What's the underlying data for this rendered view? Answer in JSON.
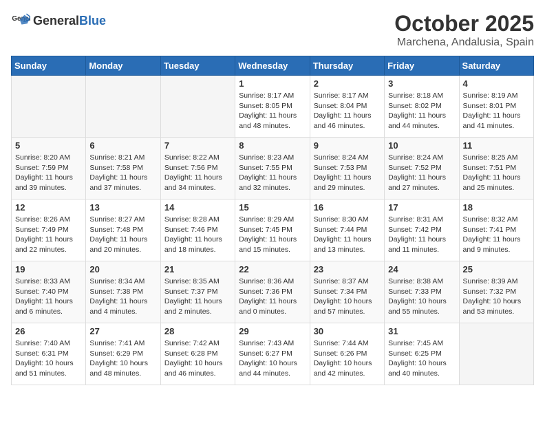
{
  "logo": {
    "general": "General",
    "blue": "Blue"
  },
  "header": {
    "month": "October 2025",
    "location": "Marchena, Andalusia, Spain"
  },
  "weekdays": [
    "Sunday",
    "Monday",
    "Tuesday",
    "Wednesday",
    "Thursday",
    "Friday",
    "Saturday"
  ],
  "weeks": [
    [
      {
        "day": "",
        "info": ""
      },
      {
        "day": "",
        "info": ""
      },
      {
        "day": "",
        "info": ""
      },
      {
        "day": "1",
        "info": "Sunrise: 8:17 AM\nSunset: 8:05 PM\nDaylight: 11 hours and 48 minutes."
      },
      {
        "day": "2",
        "info": "Sunrise: 8:17 AM\nSunset: 8:04 PM\nDaylight: 11 hours and 46 minutes."
      },
      {
        "day": "3",
        "info": "Sunrise: 8:18 AM\nSunset: 8:02 PM\nDaylight: 11 hours and 44 minutes."
      },
      {
        "day": "4",
        "info": "Sunrise: 8:19 AM\nSunset: 8:01 PM\nDaylight: 11 hours and 41 minutes."
      }
    ],
    [
      {
        "day": "5",
        "info": "Sunrise: 8:20 AM\nSunset: 7:59 PM\nDaylight: 11 hours and 39 minutes."
      },
      {
        "day": "6",
        "info": "Sunrise: 8:21 AM\nSunset: 7:58 PM\nDaylight: 11 hours and 37 minutes."
      },
      {
        "day": "7",
        "info": "Sunrise: 8:22 AM\nSunset: 7:56 PM\nDaylight: 11 hours and 34 minutes."
      },
      {
        "day": "8",
        "info": "Sunrise: 8:23 AM\nSunset: 7:55 PM\nDaylight: 11 hours and 32 minutes."
      },
      {
        "day": "9",
        "info": "Sunrise: 8:24 AM\nSunset: 7:53 PM\nDaylight: 11 hours and 29 minutes."
      },
      {
        "day": "10",
        "info": "Sunrise: 8:24 AM\nSunset: 7:52 PM\nDaylight: 11 hours and 27 minutes."
      },
      {
        "day": "11",
        "info": "Sunrise: 8:25 AM\nSunset: 7:51 PM\nDaylight: 11 hours and 25 minutes."
      }
    ],
    [
      {
        "day": "12",
        "info": "Sunrise: 8:26 AM\nSunset: 7:49 PM\nDaylight: 11 hours and 22 minutes."
      },
      {
        "day": "13",
        "info": "Sunrise: 8:27 AM\nSunset: 7:48 PM\nDaylight: 11 hours and 20 minutes."
      },
      {
        "day": "14",
        "info": "Sunrise: 8:28 AM\nSunset: 7:46 PM\nDaylight: 11 hours and 18 minutes."
      },
      {
        "day": "15",
        "info": "Sunrise: 8:29 AM\nSunset: 7:45 PM\nDaylight: 11 hours and 15 minutes."
      },
      {
        "day": "16",
        "info": "Sunrise: 8:30 AM\nSunset: 7:44 PM\nDaylight: 11 hours and 13 minutes."
      },
      {
        "day": "17",
        "info": "Sunrise: 8:31 AM\nSunset: 7:42 PM\nDaylight: 11 hours and 11 minutes."
      },
      {
        "day": "18",
        "info": "Sunrise: 8:32 AM\nSunset: 7:41 PM\nDaylight: 11 hours and 9 minutes."
      }
    ],
    [
      {
        "day": "19",
        "info": "Sunrise: 8:33 AM\nSunset: 7:40 PM\nDaylight: 11 hours and 6 minutes."
      },
      {
        "day": "20",
        "info": "Sunrise: 8:34 AM\nSunset: 7:38 PM\nDaylight: 11 hours and 4 minutes."
      },
      {
        "day": "21",
        "info": "Sunrise: 8:35 AM\nSunset: 7:37 PM\nDaylight: 11 hours and 2 minutes."
      },
      {
        "day": "22",
        "info": "Sunrise: 8:36 AM\nSunset: 7:36 PM\nDaylight: 11 hours and 0 minutes."
      },
      {
        "day": "23",
        "info": "Sunrise: 8:37 AM\nSunset: 7:34 PM\nDaylight: 10 hours and 57 minutes."
      },
      {
        "day": "24",
        "info": "Sunrise: 8:38 AM\nSunset: 7:33 PM\nDaylight: 10 hours and 55 minutes."
      },
      {
        "day": "25",
        "info": "Sunrise: 8:39 AM\nSunset: 7:32 PM\nDaylight: 10 hours and 53 minutes."
      }
    ],
    [
      {
        "day": "26",
        "info": "Sunrise: 7:40 AM\nSunset: 6:31 PM\nDaylight: 10 hours and 51 minutes."
      },
      {
        "day": "27",
        "info": "Sunrise: 7:41 AM\nSunset: 6:29 PM\nDaylight: 10 hours and 48 minutes."
      },
      {
        "day": "28",
        "info": "Sunrise: 7:42 AM\nSunset: 6:28 PM\nDaylight: 10 hours and 46 minutes."
      },
      {
        "day": "29",
        "info": "Sunrise: 7:43 AM\nSunset: 6:27 PM\nDaylight: 10 hours and 44 minutes."
      },
      {
        "day": "30",
        "info": "Sunrise: 7:44 AM\nSunset: 6:26 PM\nDaylight: 10 hours and 42 minutes."
      },
      {
        "day": "31",
        "info": "Sunrise: 7:45 AM\nSunset: 6:25 PM\nDaylight: 10 hours and 40 minutes."
      },
      {
        "day": "",
        "info": ""
      }
    ]
  ]
}
